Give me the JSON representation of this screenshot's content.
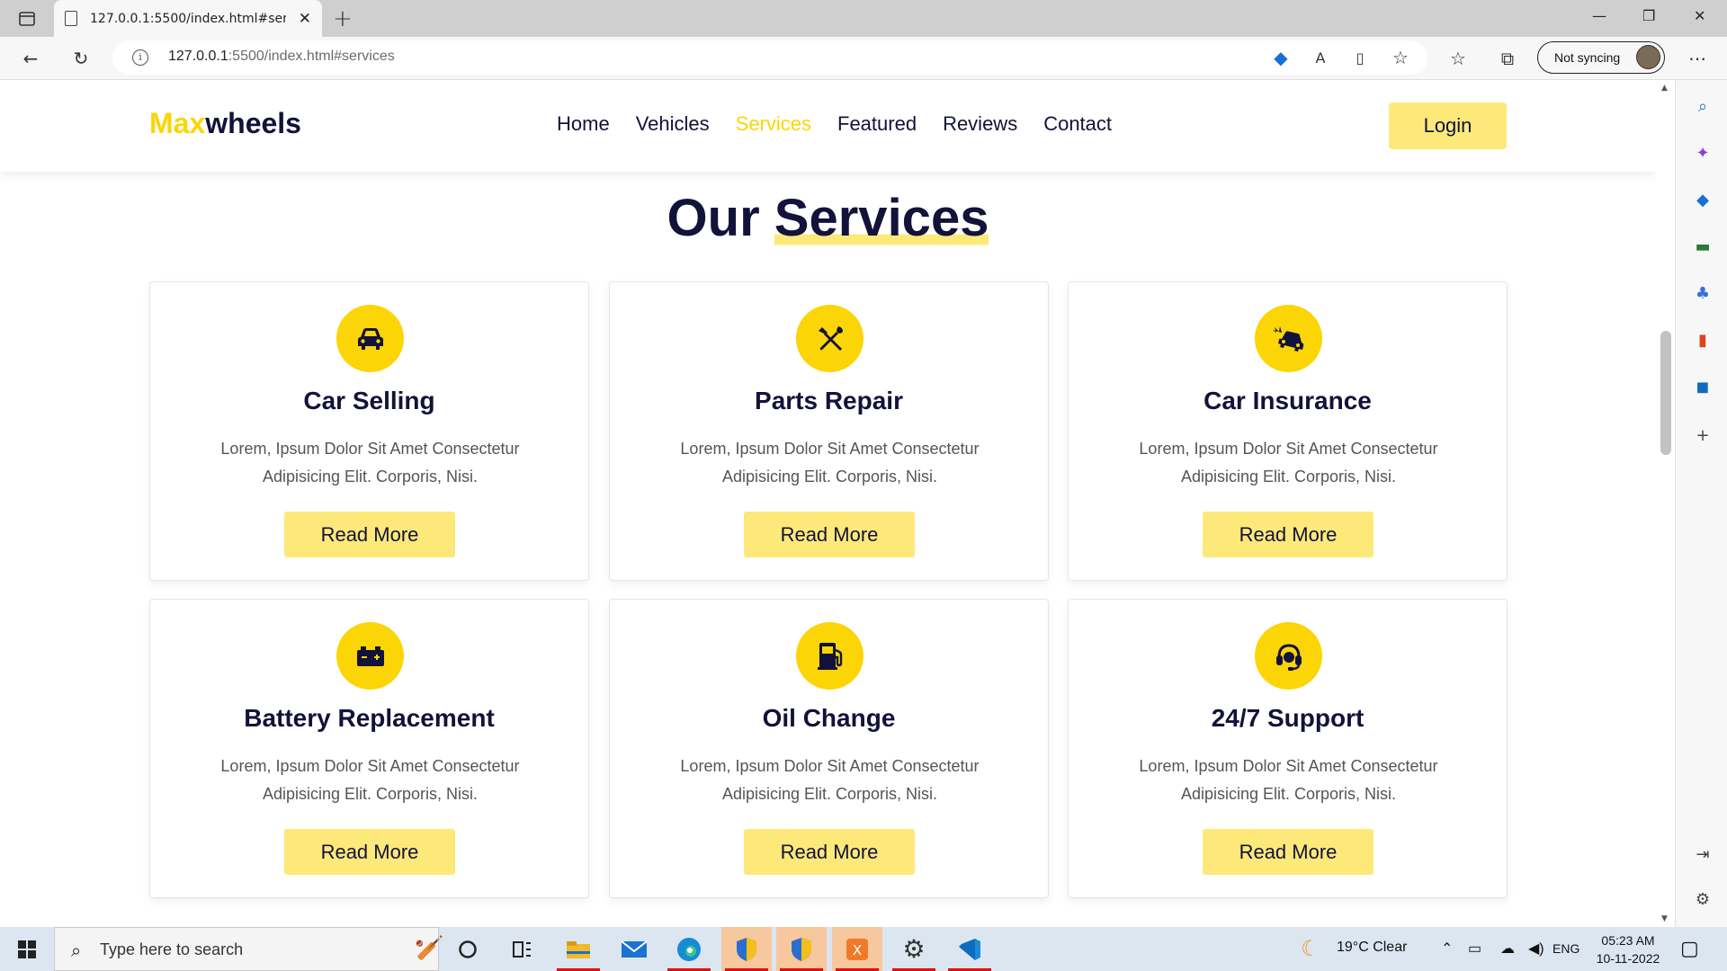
{
  "browser": {
    "tab_title": "127.0.0.1:5500/index.html#servic",
    "url_host": "127.0.0.1",
    "url_rest": ":5500/index.html#services",
    "sync_label": "Not syncing"
  },
  "site": {
    "logo_accent": "Max",
    "logo_rest": "wheels",
    "nav": [
      "Home",
      "Vehicles",
      "Services",
      "Featured",
      "Reviews",
      "Contact"
    ],
    "active_nav": "Services",
    "login_label": "Login",
    "section_title_a": "Our",
    "section_title_b": "Services"
  },
  "services": [
    {
      "title": "Car Selling",
      "icon": "car-icon",
      "desc": "Lorem, Ipsum Dolor Sit Amet Consectetur Adipisicing Elit. Corporis, Nisi.",
      "button": "Read More"
    },
    {
      "title": "Parts Repair",
      "icon": "tools-icon",
      "desc": "Lorem, Ipsum Dolor Sit Amet Consectetur Adipisicing Elit. Corporis, Nisi.",
      "button": "Read More"
    },
    {
      "title": "Car Insurance",
      "icon": "car-crash-icon",
      "desc": "Lorem, Ipsum Dolor Sit Amet Consectetur Adipisicing Elit. Corporis, Nisi.",
      "button": "Read More"
    },
    {
      "title": "Battery Replacement",
      "icon": "car-battery-icon",
      "desc": "Lorem, Ipsum Dolor Sit Amet Consectetur Adipisicing Elit. Corporis, Nisi.",
      "button": "Read More"
    },
    {
      "title": "Oil Change",
      "icon": "gas-pump-icon",
      "desc": "Lorem, Ipsum Dolor Sit Amet Consectetur Adipisicing Elit. Corporis, Nisi.",
      "button": "Read More"
    },
    {
      "title": "24/7 Support",
      "icon": "headset-icon",
      "desc": "Lorem, Ipsum Dolor Sit Amet Consectetur Adipisicing Elit. Corporis, Nisi.",
      "button": "Read More"
    }
  ],
  "colors": {
    "accent": "#fbd506",
    "button_bg": "#fde97a",
    "heading": "#12123a"
  },
  "taskbar": {
    "search_placeholder": "Type here to search",
    "weather": "19°C  Clear",
    "lang": "ENG",
    "time": "05:23 AM",
    "date": "10-11-2022"
  }
}
